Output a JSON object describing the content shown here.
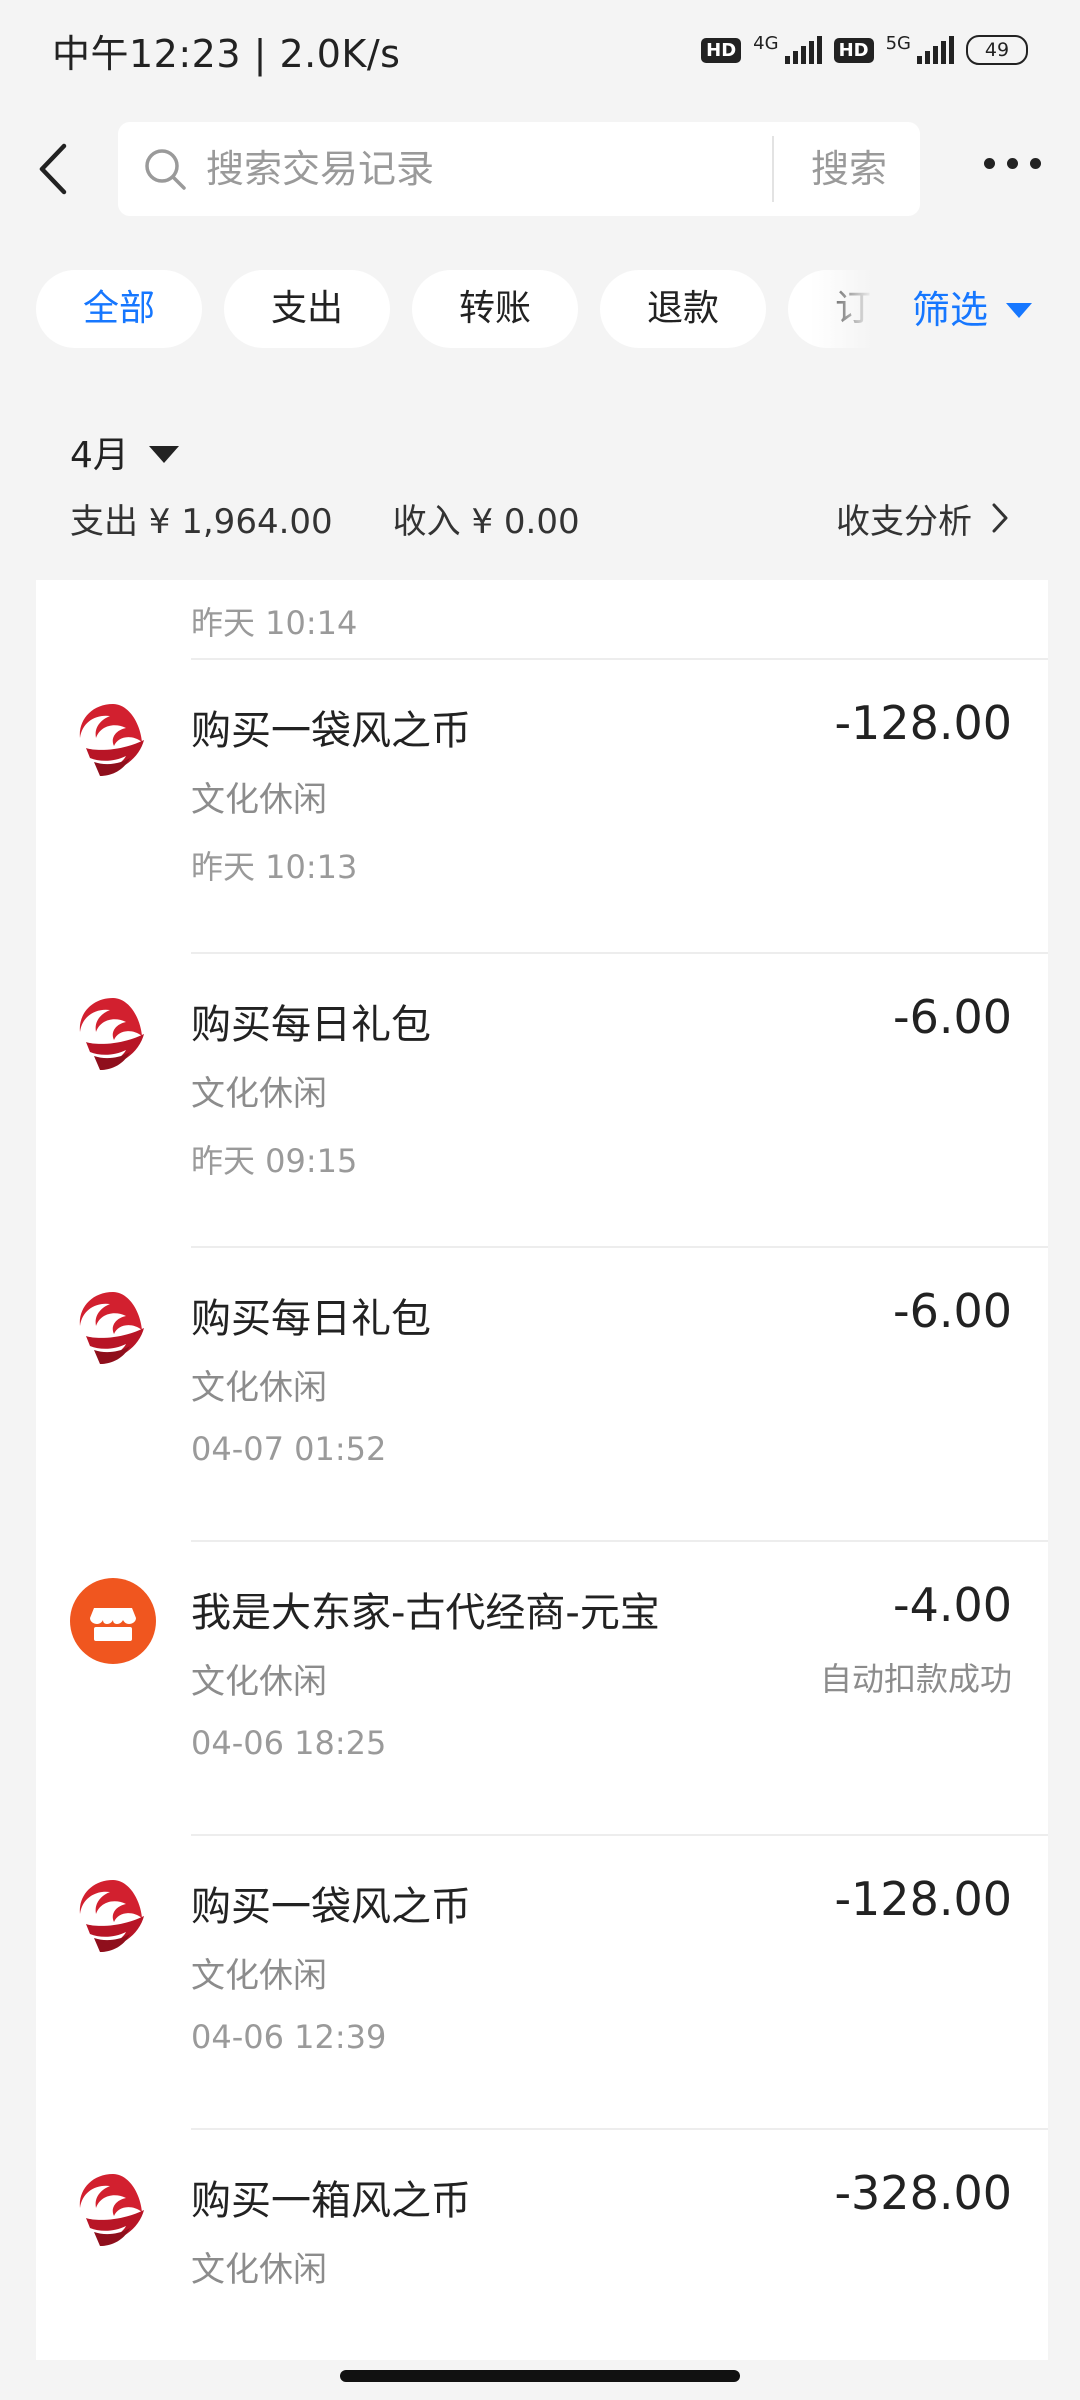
{
  "status_bar": {
    "time_speed": "中午12:23 | 2.0K/s",
    "net1": "4G",
    "net2": "5G",
    "hd": "HD",
    "battery": "49"
  },
  "header": {
    "search_placeholder": "搜索交易记录",
    "search_button": "搜索"
  },
  "filters": {
    "chips": [
      "全部",
      "支出",
      "转账",
      "退款",
      "订单"
    ],
    "active": "全部",
    "filter_label": "筛选"
  },
  "month": {
    "label": "4月",
    "expense": "支出 ¥ 1,964.00",
    "income": "收入 ¥ 0.00",
    "analysis": "收支分析"
  },
  "transactions": [
    {
      "partial": true,
      "time": "昨天 10:14"
    },
    {
      "icon": "fengzhi-logo-icon",
      "title": "购买一袋风之币",
      "category": "文化休闲",
      "time": "昨天 10:13",
      "amount": "-128.00",
      "note": ""
    },
    {
      "icon": "fengzhi-logo-icon",
      "title": "购买每日礼包",
      "category": "文化休闲",
      "time": "昨天 09:15",
      "amount": "-6.00",
      "note": ""
    },
    {
      "icon": "fengzhi-logo-icon",
      "title": "购买每日礼包",
      "category": "文化休闲",
      "time": "04-07 01:52",
      "amount": "-6.00",
      "note": ""
    },
    {
      "icon": "shop-icon",
      "title": "我是大东家-古代经商-元宝",
      "category": "文化休闲",
      "time": "04-06 18:25",
      "amount": "-4.00",
      "note": "自动扣款成功"
    },
    {
      "icon": "fengzhi-logo-icon",
      "title": "购买一袋风之币",
      "category": "文化休闲",
      "time": "04-06 12:39",
      "amount": "-128.00",
      "note": ""
    },
    {
      "icon": "fengzhi-logo-icon",
      "title": "购买一箱风之币",
      "category": "文化休闲",
      "time": "",
      "amount": "-328.00",
      "note": ""
    }
  ],
  "colors": {
    "accent": "#1677ff",
    "logo_red": "#d2202f",
    "shop_orange": "#f0561f"
  }
}
